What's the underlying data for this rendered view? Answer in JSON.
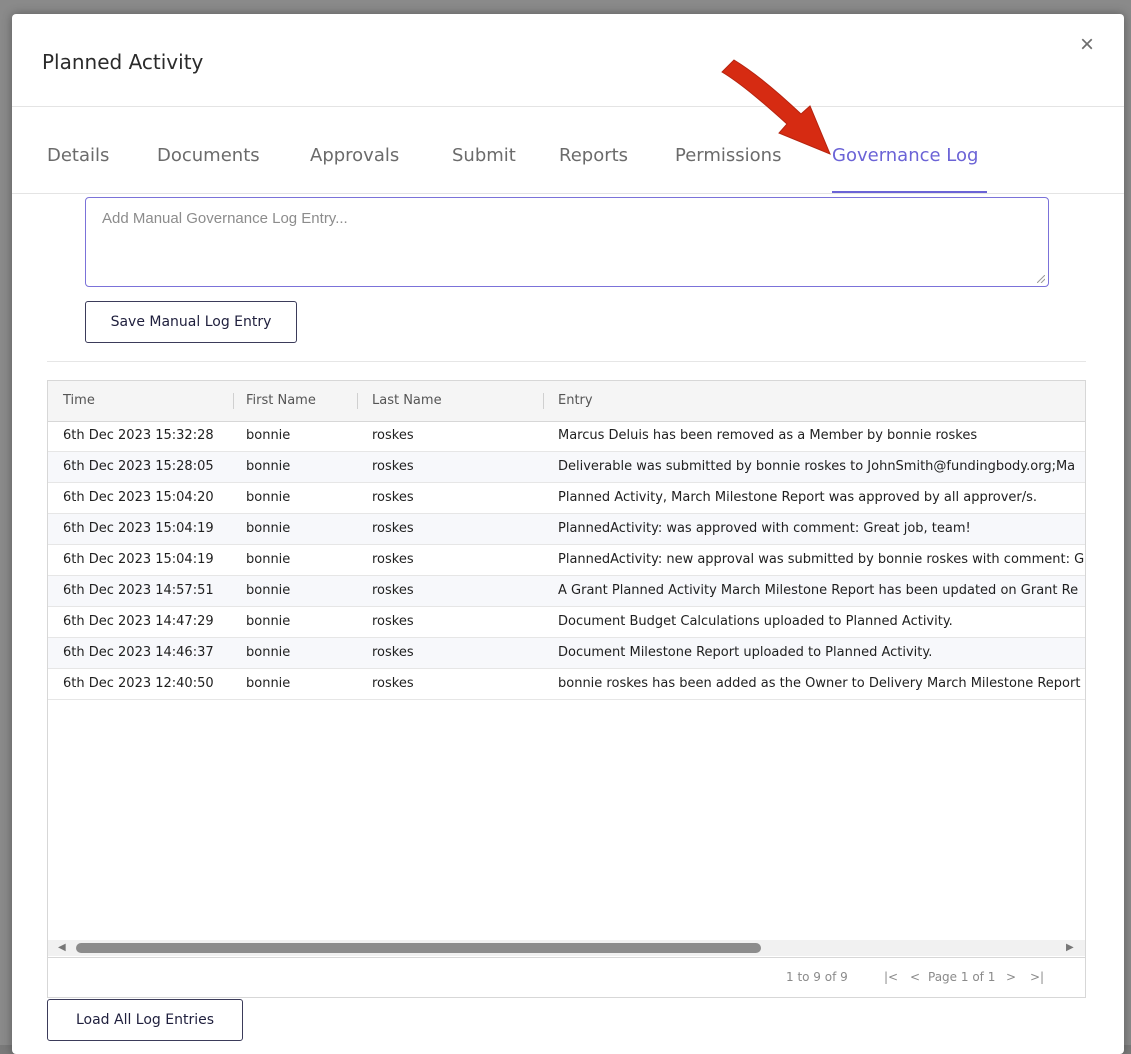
{
  "modal": {
    "title": "Planned Activity",
    "close_glyph": "×"
  },
  "tabs": [
    {
      "label": "Details"
    },
    {
      "label": "Documents"
    },
    {
      "label": "Approvals"
    },
    {
      "label": "Submit"
    },
    {
      "label": "Reports"
    },
    {
      "label": "Permissions"
    },
    {
      "label": "Governance Log"
    }
  ],
  "active_tab": "Governance Log",
  "manual_entry": {
    "placeholder": "Add Manual Governance Log Entry...",
    "value": "",
    "save_label": "Save Manual Log Entry"
  },
  "grid": {
    "columns": [
      "Time",
      "First Name",
      "Last Name",
      "Entry"
    ],
    "rows": [
      {
        "time": "6th Dec 2023 15:32:28",
        "first": "bonnie",
        "last": "roskes",
        "entry": "Marcus Deluis has been removed as a Member by bonnie roskes"
      },
      {
        "time": "6th Dec 2023 15:28:05",
        "first": "bonnie",
        "last": "roskes",
        "entry": "Deliverable was submitted by bonnie roskes to JohnSmith@fundingbody.org;Ma"
      },
      {
        "time": "6th Dec 2023 15:04:20",
        "first": "bonnie",
        "last": "roskes",
        "entry": "Planned Activity, March Milestone Report was approved by all approver/s."
      },
      {
        "time": "6th Dec 2023 15:04:19",
        "first": "bonnie",
        "last": "roskes",
        "entry": "PlannedActivity: was approved with comment: Great job, team!"
      },
      {
        "time": "6th Dec 2023 15:04:19",
        "first": "bonnie",
        "last": "roskes",
        "entry": "PlannedActivity: new approval was submitted by bonnie roskes with comment: G"
      },
      {
        "time": "6th Dec 2023 14:57:51",
        "first": "bonnie",
        "last": "roskes",
        "entry": "A Grant Planned Activity March Milestone Report has been updated on Grant Re"
      },
      {
        "time": "6th Dec 2023 14:47:29",
        "first": "bonnie",
        "last": "roskes",
        "entry": "Document Budget Calculations uploaded to Planned Activity."
      },
      {
        "time": "6th Dec 2023 14:46:37",
        "first": "bonnie",
        "last": "roskes",
        "entry": "Document Milestone Report uploaded to Planned Activity."
      },
      {
        "time": "6th Dec 2023 12:40:50",
        "first": "bonnie",
        "last": "roskes",
        "entry": "bonnie roskes has been added as the Owner to Delivery March Milestone Report"
      }
    ],
    "pager": {
      "summary": "1 to 9 of 9",
      "first": "|<",
      "prev": "<",
      "page_text": "Page 1 of 1",
      "next": ">",
      "last": ">|"
    }
  },
  "load_all_label": "Load All Log Entries",
  "colors": {
    "accent": "#6b63d6",
    "arrow": "#d62b12"
  },
  "icons": [
    "close-icon",
    "arrow-annotation",
    "scroll-left-icon",
    "scroll-right-icon"
  ]
}
